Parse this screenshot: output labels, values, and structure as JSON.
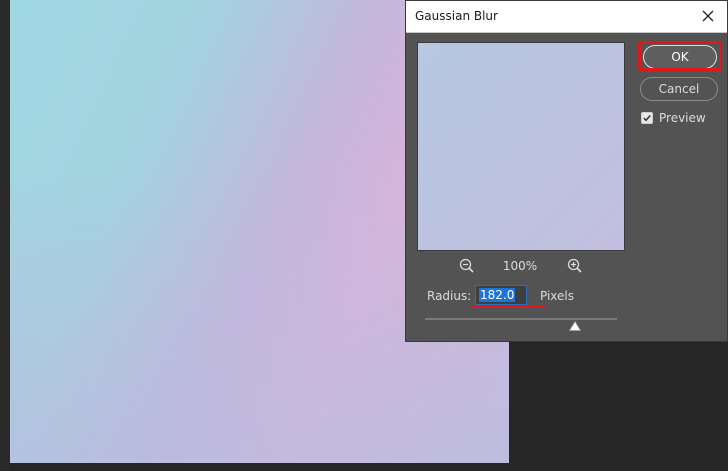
{
  "dialog": {
    "title": "Gaussian Blur",
    "ok_label": "OK",
    "cancel_label": "Cancel",
    "preview_label": "Preview",
    "preview_checked": true,
    "zoom_percent": "100%",
    "radius_label": "Radius:",
    "radius_value": "182.0",
    "radius_unit": "Pixels",
    "slider_level": 0.78
  },
  "colors": {
    "highlight": "#e21818",
    "dialog_bg": "#535353",
    "selection": "#1f74d9"
  }
}
